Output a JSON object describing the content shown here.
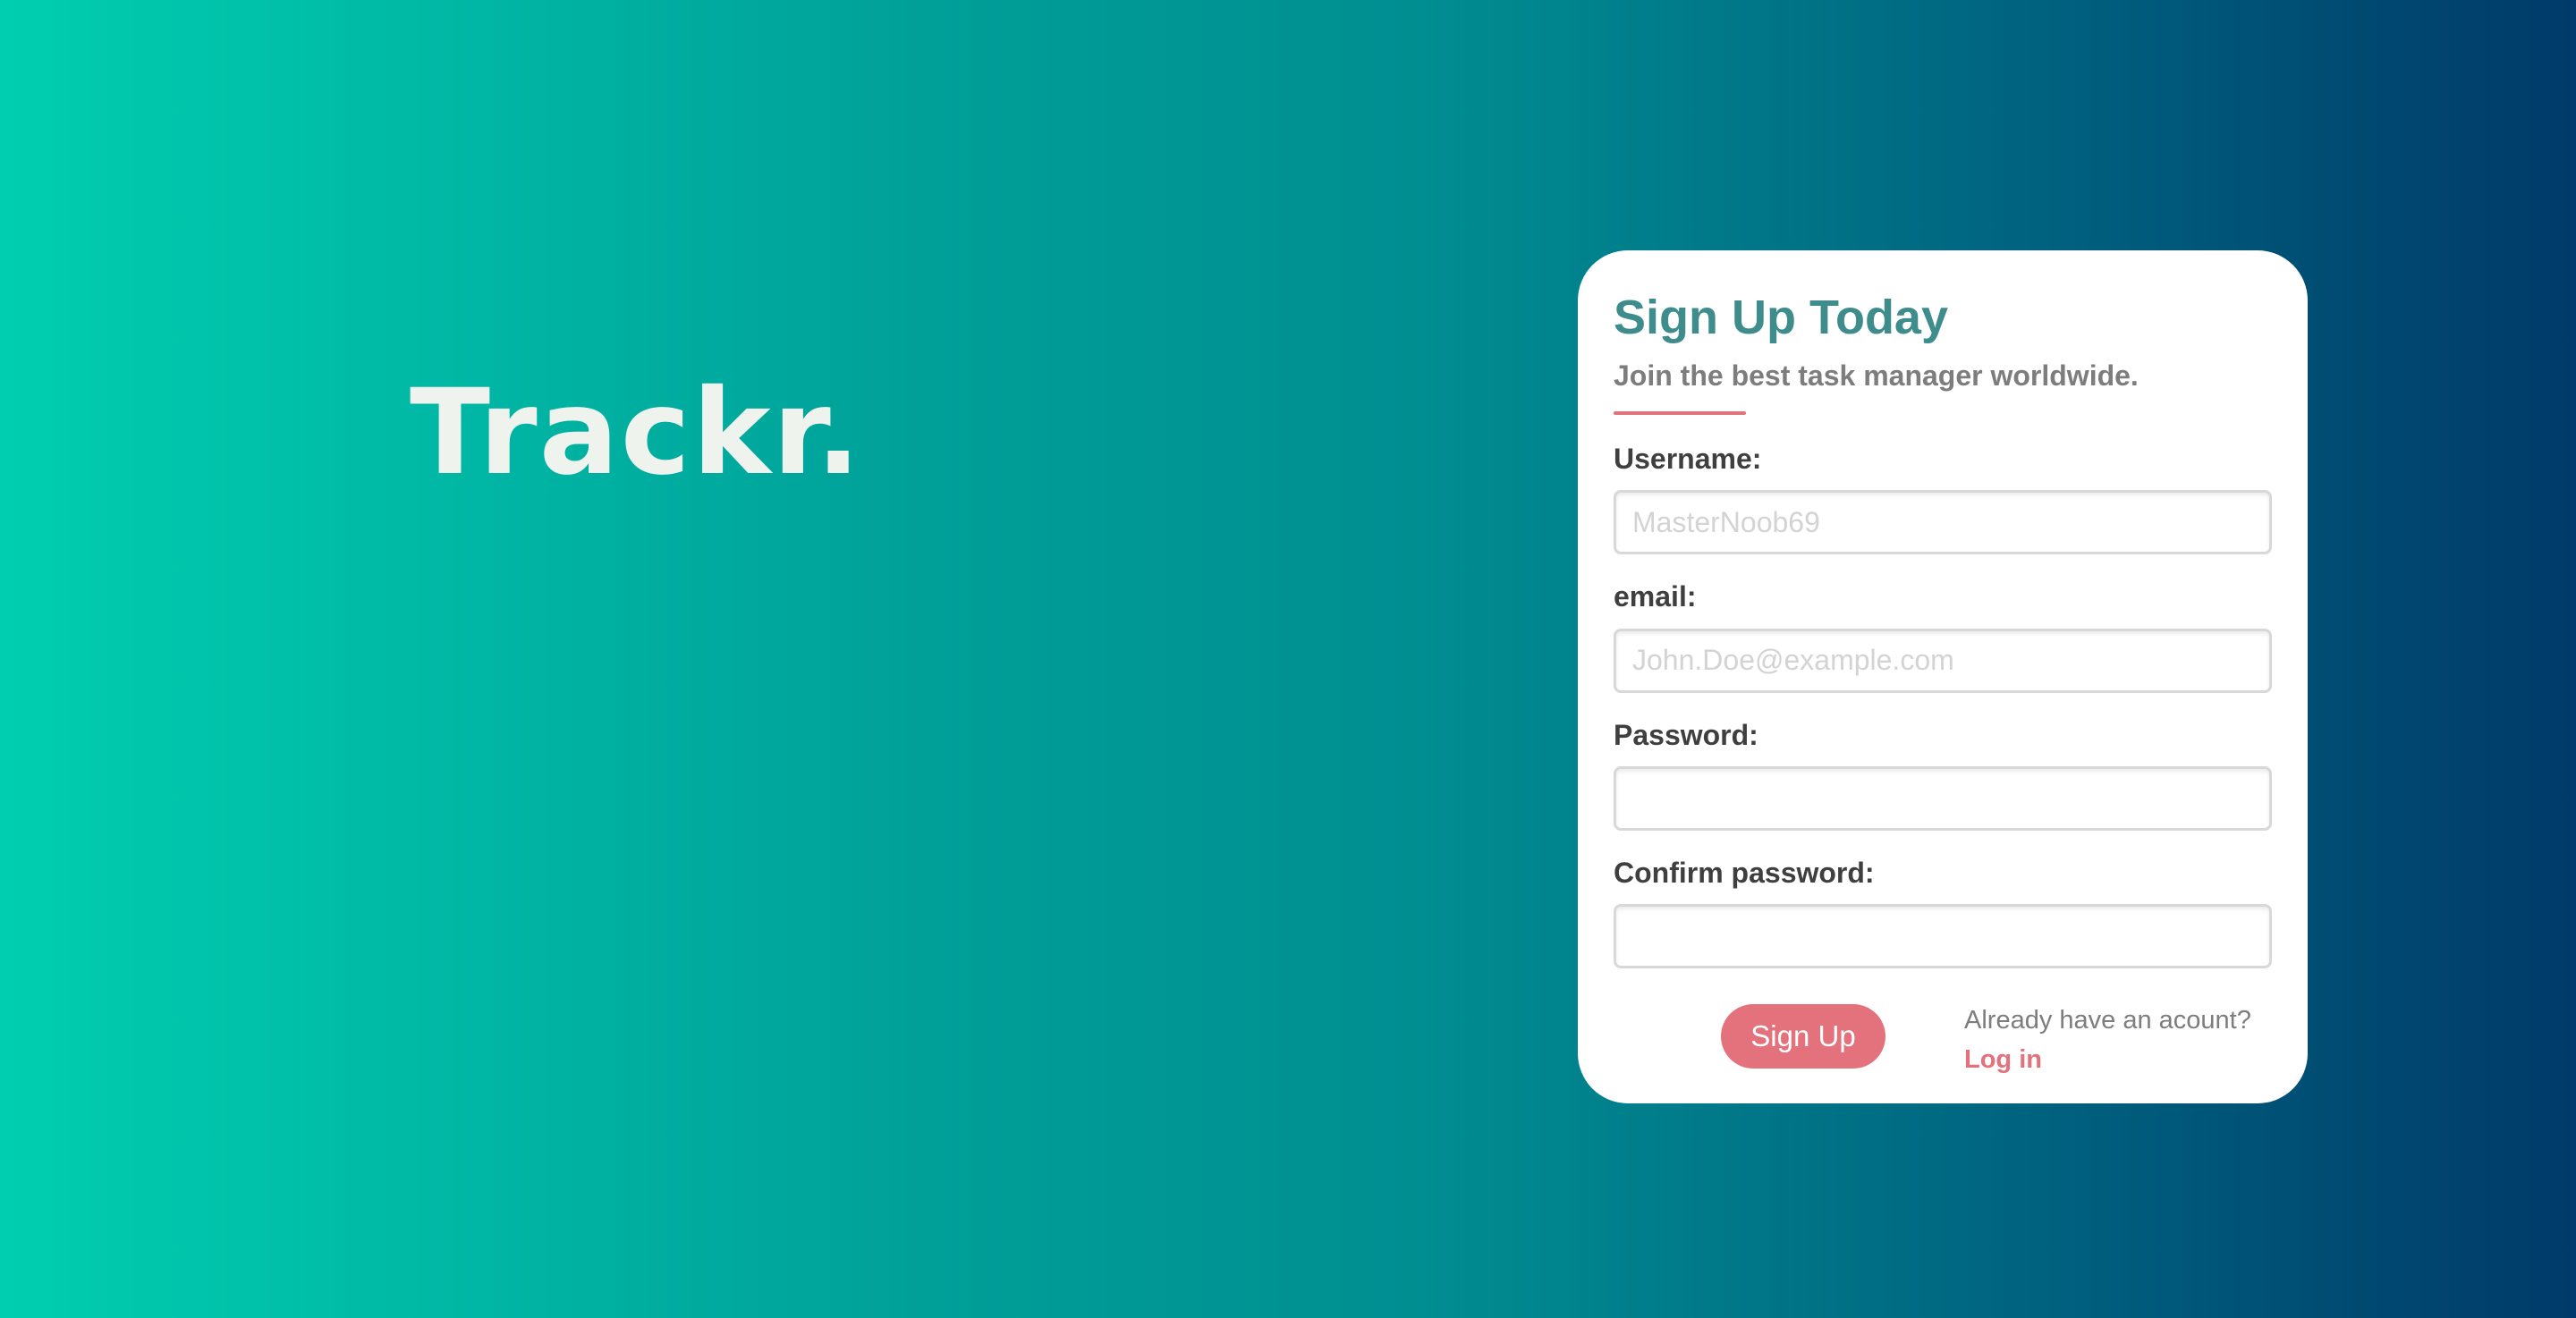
{
  "brand": {
    "title": "Trackr."
  },
  "signup_card": {
    "title": "Sign Up Today",
    "subtitle": "Join the best task manager worldwide.",
    "fields": {
      "username": {
        "label": "Username:",
        "value": "",
        "placeholder": "MasterNoob69"
      },
      "email": {
        "label": "email:",
        "value": "",
        "placeholder": "John.Doe@example.com"
      },
      "password": {
        "label": "Password:",
        "value": "",
        "placeholder": ""
      },
      "confirm_password": {
        "label": "Confirm password:",
        "value": "",
        "placeholder": ""
      }
    },
    "signup_button_label": "Sign Up",
    "login_prompt": "Already have an acount?",
    "login_link_label": "Log in"
  },
  "colors": {
    "gradient_start": "#00ceb0",
    "gradient_end": "#003a6a",
    "title_teal": "#3e8c8c",
    "accent_coral": "#e3727c",
    "brand_text": "#eef3ee"
  }
}
